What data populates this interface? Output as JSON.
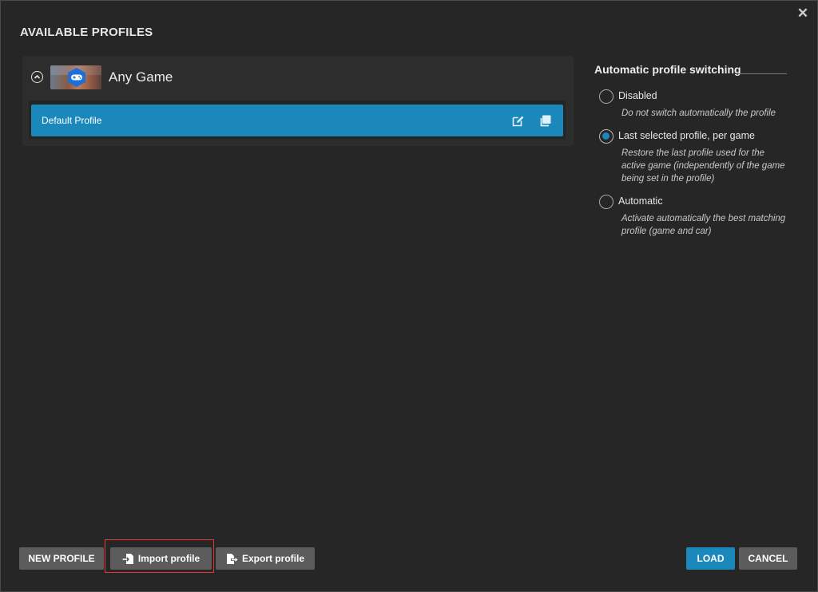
{
  "dialog": {
    "title": "AVAILABLE PROFILES",
    "close_label": "✕"
  },
  "profiles": {
    "game": {
      "name": "Any Game",
      "thumbnail_icon": "gamepad-icon"
    },
    "items": [
      {
        "label": "Default Profile",
        "selected": true,
        "edit_icon": "edit-icon",
        "duplicate_icon": "duplicate-icon"
      }
    ]
  },
  "switching": {
    "title": "Automatic profile switching",
    "selected": "last_selected",
    "options": [
      {
        "id": "disabled",
        "label": "Disabled",
        "description": "Do not switch automatically the profile"
      },
      {
        "id": "last_selected",
        "label": "Last selected profile, per game",
        "description": "Restore the last profile used for the active game (independently of the game being set in the profile)"
      },
      {
        "id": "automatic",
        "label": "Automatic",
        "description": "Activate automatically the best matching profile (game and car)"
      }
    ]
  },
  "buttons": {
    "new_profile": "NEW PROFILE",
    "import_profile": "Import profile",
    "export_profile": "Export profile",
    "load": "LOAD",
    "cancel": "CANCEL"
  },
  "colors": {
    "accent": "#1b88bc",
    "highlight": "#e53935",
    "background": "#262626"
  }
}
